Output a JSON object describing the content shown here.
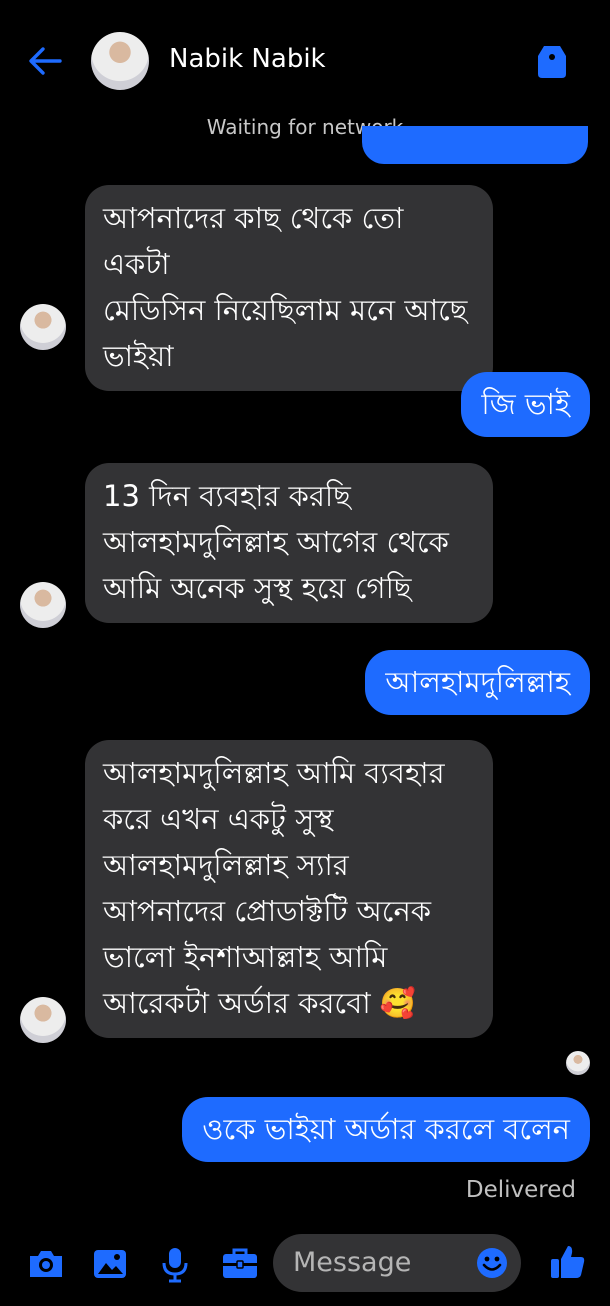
{
  "header": {
    "contact_name": "Nabik Nabik",
    "status": "Waiting for network"
  },
  "messages": [
    {
      "dir": "in",
      "text": "আপনাদের কাছ থেকে তো একটা\nমেডিসিন নিয়েছিলাম মনে আছে\nভাইয়া"
    },
    {
      "dir": "out",
      "text": "জি ভাই"
    },
    {
      "dir": "in",
      "text": "13 দিন ব্যবহার করছি\nআলহামদুলিল্লাহ আগের থেকে\nআমি অনেক সুস্থ হয়ে গেছি"
    },
    {
      "dir": "out",
      "text": "আলহামদুলিল্লাহ"
    },
    {
      "dir": "in",
      "text": "আলহামদুলিল্লাহ আমি ব্যবহার\nকরে এখন একটু সুস্থ\nআলহামদুলিল্লাহ স্যার\nআপনাদের প্রোডাক্টটি অনেক\nভালো ইনশাআল্লাহ  আমি\nআরেকটা অর্ডার করবো 🥰"
    },
    {
      "dir": "out",
      "text": "ওকে ভাইয়া অর্ডার করলে বলেন"
    }
  ],
  "delivery_status": "Delivered",
  "composer": {
    "placeholder": "Message"
  },
  "colors": {
    "accent": "#1e6bff",
    "incoming_bubble": "#333335",
    "background": "#000000"
  },
  "icons": [
    "back-arrow-icon",
    "shield-icon",
    "camera-icon",
    "gallery-icon",
    "microphone-icon",
    "toolbox-icon",
    "emoji-icon",
    "like-icon"
  ]
}
